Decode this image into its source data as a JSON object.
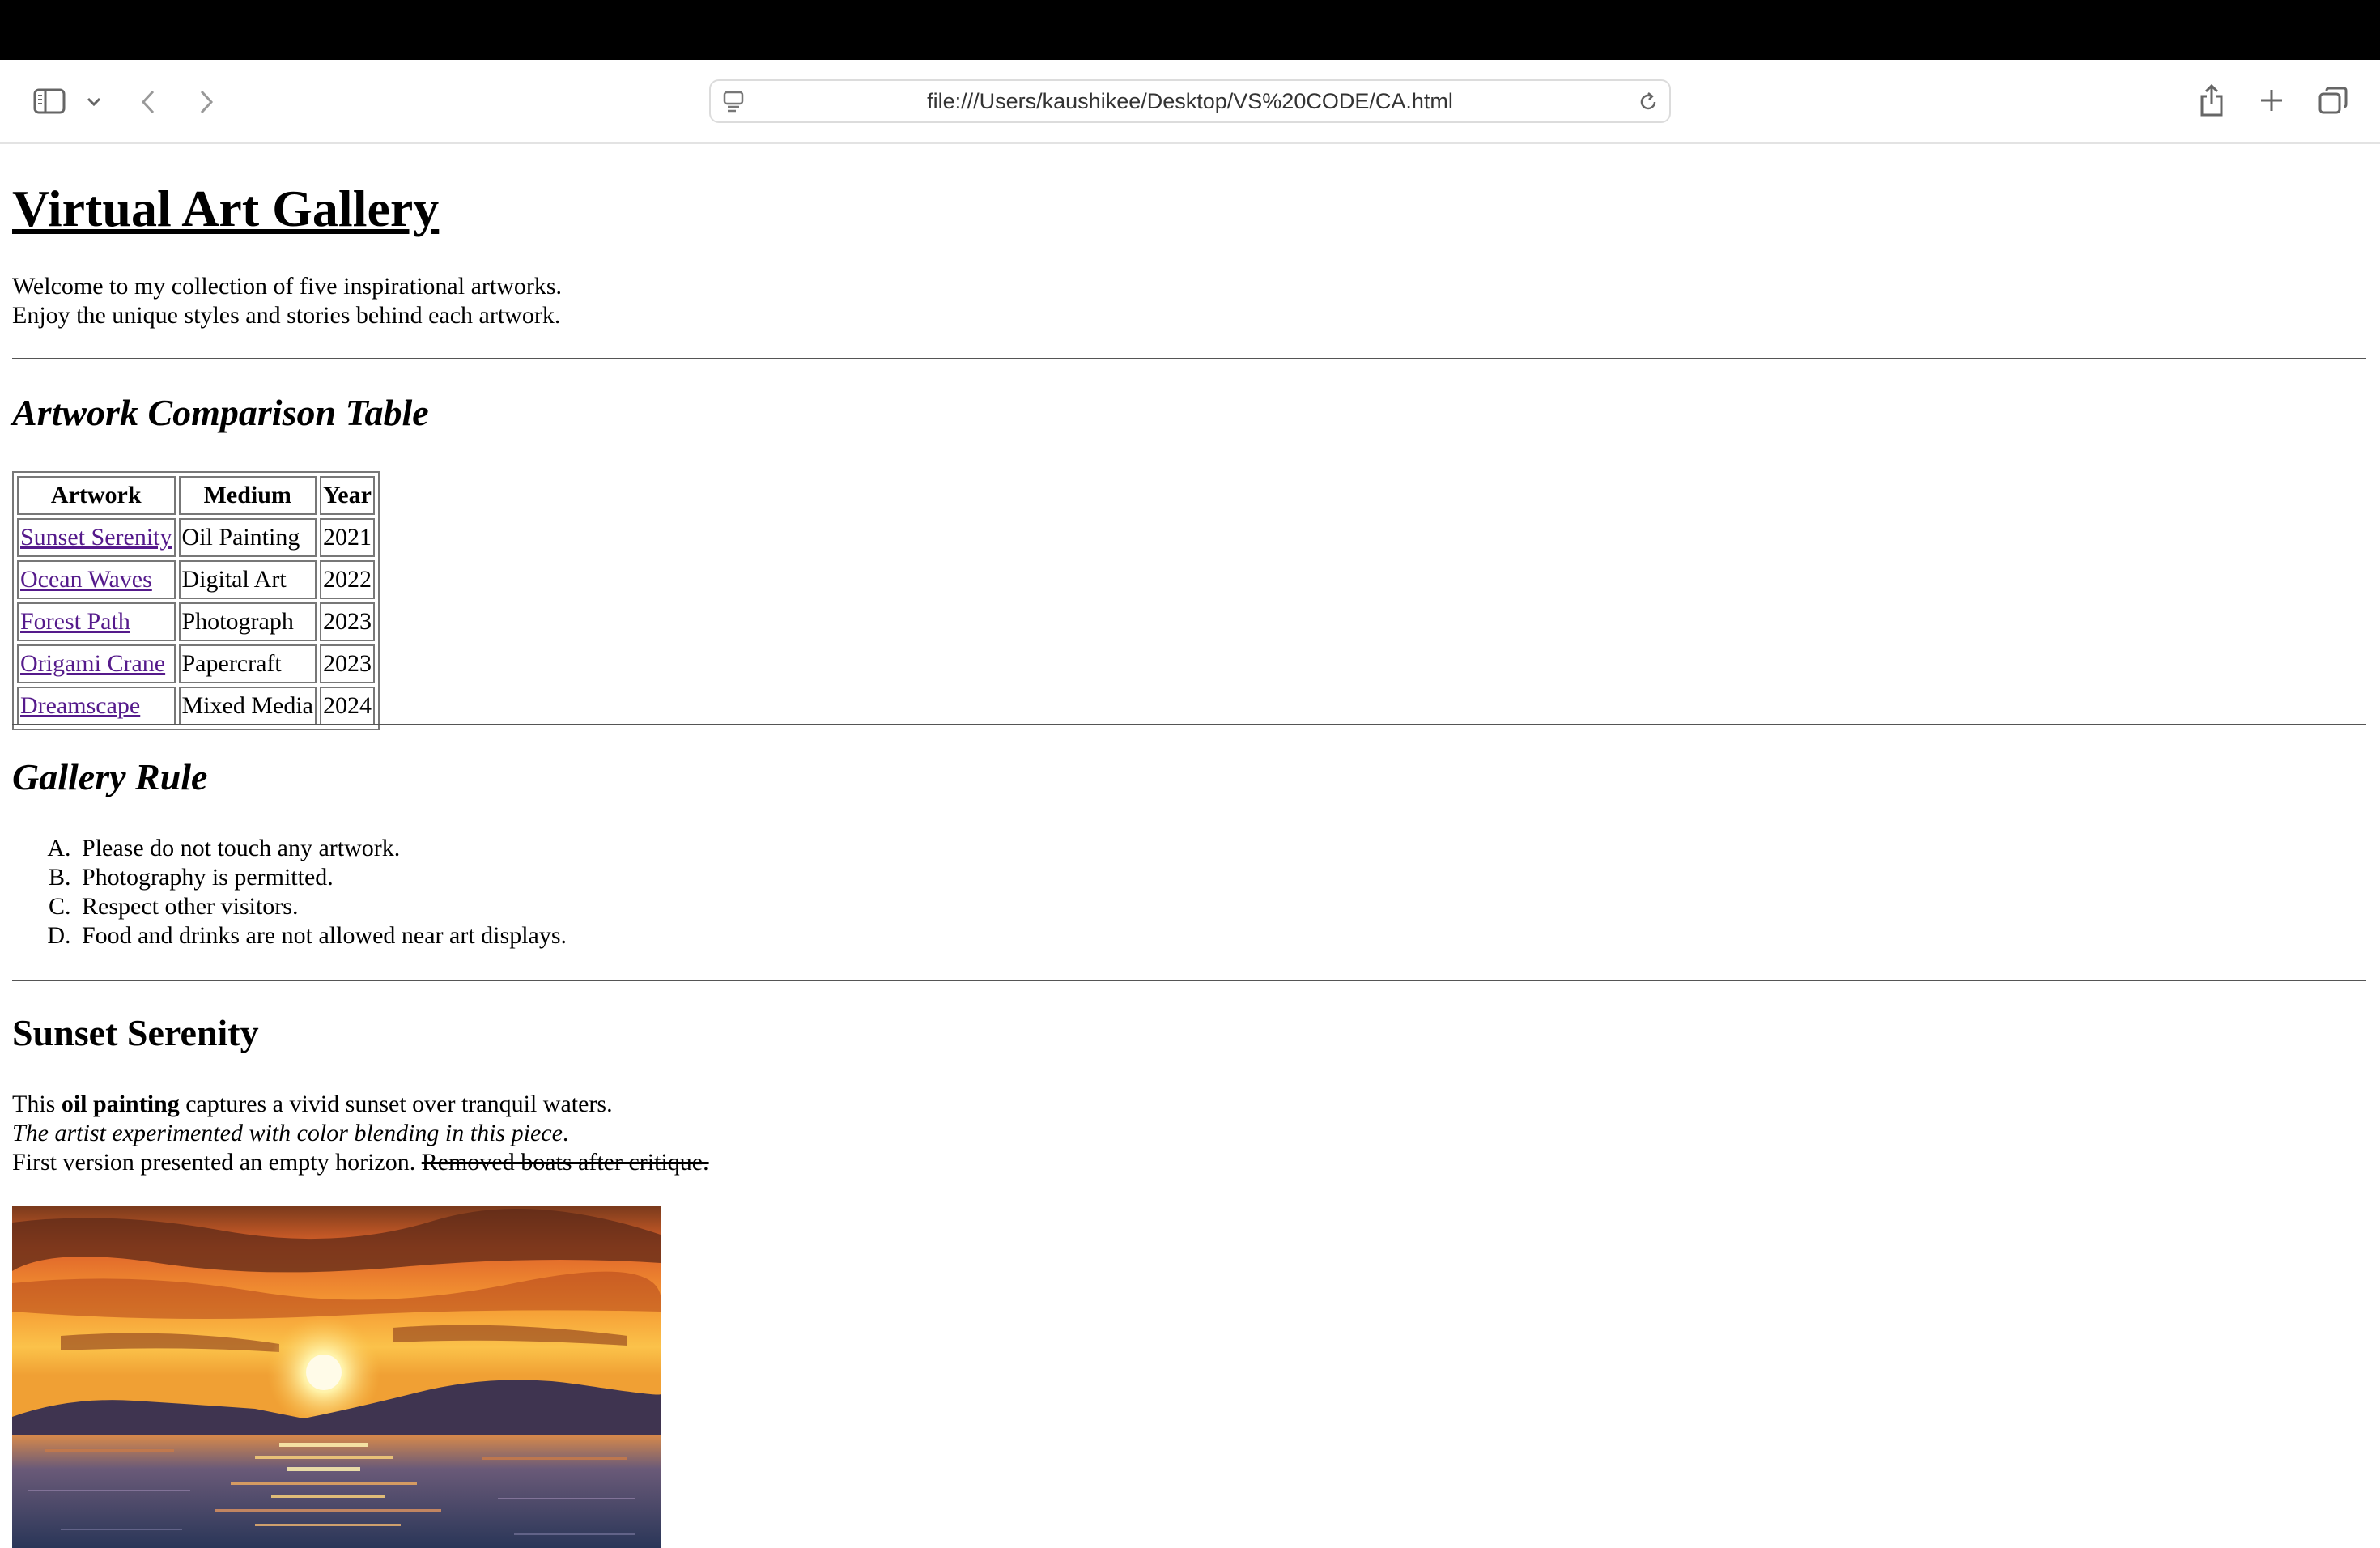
{
  "browser": {
    "url": "file:///Users/kaushikee/Desktop/VS%20CODE/CA.html"
  },
  "page": {
    "title": "Virtual Art Gallery",
    "intro_line1": "Welcome to my collection of five inspirational artworks.",
    "intro_line2": "Enjoy the unique styles and stories behind each artwork.",
    "table_heading": "Artwork Comparison Table",
    "table": {
      "headers": [
        "Artwork",
        "Medium",
        "Year"
      ],
      "rows": [
        {
          "artwork": "Sunset Serenity",
          "medium": "Oil Painting",
          "year": "2021"
        },
        {
          "artwork": "Ocean Waves",
          "medium": "Digital Art",
          "year": "2022"
        },
        {
          "artwork": "Forest Path",
          "medium": "Photograph",
          "year": "2023"
        },
        {
          "artwork": "Origami Crane",
          "medium": "Papercraft",
          "year": "2023"
        },
        {
          "artwork": "Dreamscape",
          "medium": "Mixed Media",
          "year": "2024"
        }
      ]
    },
    "rules_heading": "Gallery Rule",
    "rules": [
      "Please do not touch any artwork.",
      "Photography is permitted.",
      "Respect other visitors.",
      "Food and drinks are not allowed near art displays."
    ],
    "section": {
      "heading": "Sunset Serenity",
      "line1_pre": "This ",
      "line1_bold": "oil painting",
      "line1_post": " captures a vivid sunset over tranquil waters.",
      "line2_italic": "The artist experimented with color blending in this piece",
      "line2_end": ".",
      "line3_plain": "First version presented an empty horizon. ",
      "line3_struck": "Removed boats after critique."
    }
  },
  "colors": {
    "link_visited": "#551a8b",
    "rule": "#555555",
    "chrome_bar": "#000000"
  }
}
